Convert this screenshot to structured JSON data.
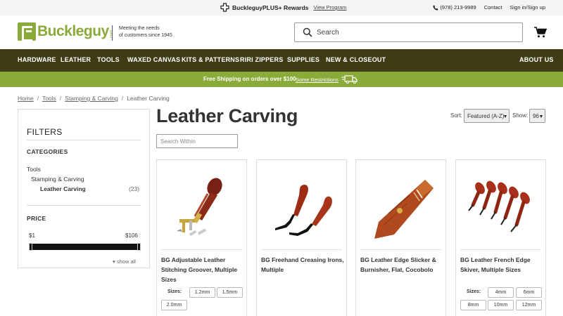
{
  "topbar": {
    "promo_brand": "BuckleguyPLUS+ Rewards",
    "promo_link": "View Program",
    "phone": "(978) 213-9989",
    "contact": "Contact",
    "signin": "Sign in/Sign up"
  },
  "header": {
    "logo_text": "Buckleguy",
    "logo_suffix": ".com",
    "tagline_line1": "Meeting the needs",
    "tagline_line2": "of customers since 1945",
    "search_placeholder": "Search",
    "icons": [
      "search-icon",
      "cart-icon"
    ]
  },
  "nav": {
    "items": [
      "HARDWARE",
      "LEATHER",
      "TOOLS",
      "WAXED CANVAS",
      "KITS & PATTERNS",
      "RIRI ZIPPERS",
      "SUPPLIES",
      "NEW & CLOSEOUT"
    ],
    "right_item": "ABOUT US"
  },
  "shipping": {
    "text": "Free Shipping on orders over $100",
    "link": "Some Restrictions"
  },
  "breadcrumb": [
    "Home",
    "Tools",
    "Stamping & Carving",
    "Leather Carving"
  ],
  "sidebar": {
    "title": "FILTERS",
    "categories_heading": "CATEGORIES",
    "categories": [
      {
        "label": "Tools"
      },
      {
        "label": "Stamping & Carving"
      },
      {
        "label": "Leather Carving",
        "count": "(23)"
      }
    ],
    "price_heading": "PRICE",
    "price_min": "$1",
    "price_max": "$106",
    "show_all": "▾ show all"
  },
  "main": {
    "title": "Leather Carving",
    "sort_label": "Sort:",
    "sort_value": "Featured (A-Z)",
    "show_label": "Show:",
    "show_value": "96",
    "search_within_placeholder": "Search Within"
  },
  "products": [
    {
      "name": "BG Adjustable Leather Stitching Groover, Multiple Sizes",
      "sizes_label": "Sizes:",
      "sizes": [
        "1.2mm",
        "1.5mm",
        "2.0mm"
      ]
    },
    {
      "name": "BG Freehand Creasing Irons, Multiple"
    },
    {
      "name": "BG Leather Edge Slicker & Burnisher, Flat, Cocobolo"
    },
    {
      "name": "BG Leather French Edge Skiver, Multiple Sizes",
      "sizes_label": "Sizes:",
      "sizes": [
        "4mm",
        "6mm",
        "8mm",
        "10mm",
        "12mm"
      ]
    }
  ],
  "colors": {
    "brand_green": "#8aaa3a",
    "nav_bg": "#3f3b14"
  }
}
